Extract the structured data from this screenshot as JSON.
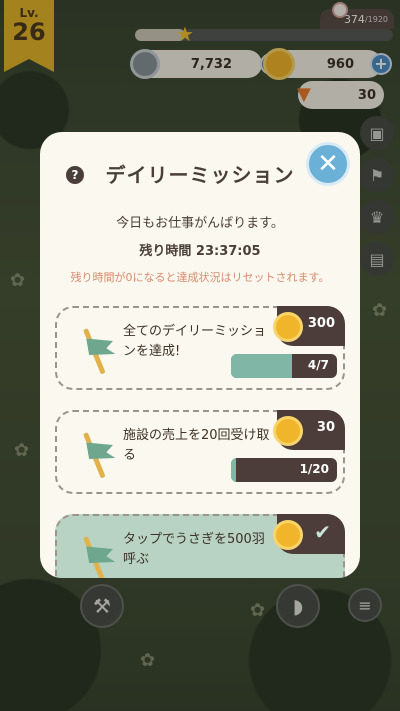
{
  "hud": {
    "level_label": "Lv.",
    "level_value": "26",
    "xp_current": "374",
    "xp_max": "/1920",
    "xp_fraction": 0.195,
    "silver_coins": "7,732",
    "gold_coins": "960",
    "carrots": "30"
  },
  "modal": {
    "title": "デイリーミッション",
    "subtitle": "今日もお仕事がんばります。",
    "time_remaining": "残り時間 23:37:05",
    "reset_notice": "残り時間が0になると達成状況はリセットされます。",
    "missions": [
      {
        "name": "全てのデイリーミッションを達成!",
        "reward": "300",
        "progress_text": "4/7",
        "progress": 0.571,
        "completed": false
      },
      {
        "name": "施設の売上を20回受け取る",
        "reward": "30",
        "progress_text": "1/20",
        "progress": 0.05,
        "completed": false
      },
      {
        "name": "タップでうさぎを500羽呼ぶ",
        "reward": "",
        "progress_text": "",
        "progress": 1,
        "completed": true
      }
    ]
  },
  "colors": {
    "accent_blue": "#6bb0d6",
    "mission_green": "#7fb6a5",
    "gold": "#f0b52b",
    "dark_brown": "#4c3d3a",
    "notice_orange": "#d88a6a"
  }
}
